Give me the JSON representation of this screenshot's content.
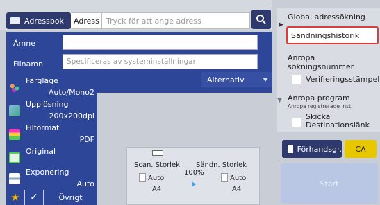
{
  "top": {
    "addressbook_label": "Adressbok",
    "address_label": "Adress",
    "address_placeholder": "Tryck för att ange adress"
  },
  "subject": {
    "amne_label": "Ämne",
    "filnamn_label": "Filnamn",
    "filnamn_placeholder": "Specificeras av systeminställningar",
    "alternativ_label": "Alternativ"
  },
  "settings": [
    {
      "label": "Färgläge",
      "value": "Auto/Mono2"
    },
    {
      "label": "Upplösning",
      "value": "200x200dpi"
    },
    {
      "label": "Filformat",
      "value": "PDF"
    },
    {
      "label": "Original",
      "value": ""
    },
    {
      "label": "Exponering",
      "value": "Auto"
    }
  ],
  "bottom": {
    "ovrigt_label": "Övrigt"
  },
  "scan": {
    "scan_size_label": "Scan. Storlek",
    "send_size_label": "Sändn. Storlek",
    "ratio": "100%",
    "scan_auto": "Auto",
    "scan_paper": "A4",
    "send_auto": "Auto",
    "send_paper": "A4"
  },
  "right": {
    "global_search": "Global adressökning",
    "send_history": "Sändningshistorik",
    "call_search_number": "Anropa sökningsnummer",
    "verification_stamp": "Verifieringsstämpel",
    "call_program": "Anropa program",
    "call_program_sub": "Anropa registrerade inst.",
    "send_destination_link_1": "Skicka",
    "send_destination_link_2": "Destinationslänk"
  },
  "actions": {
    "preview_label": "Förhandsgr.",
    "ca_label": "CA",
    "start_label": "Start"
  }
}
